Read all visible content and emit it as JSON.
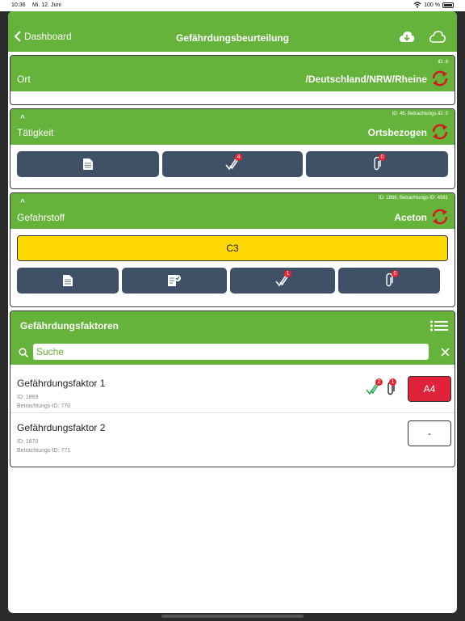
{
  "status": {
    "time": "10:36",
    "date": "Mi. 12. Juni",
    "battery": "100 %"
  },
  "nav": {
    "back_label": "Dashboard",
    "title": "Gefährdungsbeurteilung"
  },
  "ort": {
    "id": "ID:  8",
    "label": "Ort",
    "value": "/Deutschland/NRW/Rheine"
  },
  "taetigkeit": {
    "id": "ID: 45, Betrachtungs-ID: 0",
    "label": "Tätigkeit",
    "value": "Ortsbezogen",
    "badge_check": "4",
    "badge_attach": "0"
  },
  "gefahrstoff": {
    "id": "ID: 1866, Betrachtungs-ID: 4561",
    "label": "Gefahrstoff",
    "value": "Aceton",
    "rating": "C3",
    "badge_check": "1",
    "badge_attach": "0"
  },
  "faktoren": {
    "title": "Gefährdungsfaktoren",
    "search_placeholder": "Suche",
    "items": [
      {
        "title": "Gefährdungsfaktor 1",
        "id": "ID:  1869",
        "betr_id": "Betrachtungs-ID:  770",
        "badge_check": "2",
        "badge_attach": "1",
        "rating": "A4"
      },
      {
        "title": "Gefährdungsfaktor 2",
        "id": "ID:  1870",
        "betr_id": "Betrachtungs-ID:  771",
        "rating": "-"
      }
    ]
  },
  "colors": {
    "green": "#65b33a",
    "navy": "#3e5166",
    "yellow": "#fdd700",
    "red": "#e8222e",
    "badge": "#e8222e"
  }
}
